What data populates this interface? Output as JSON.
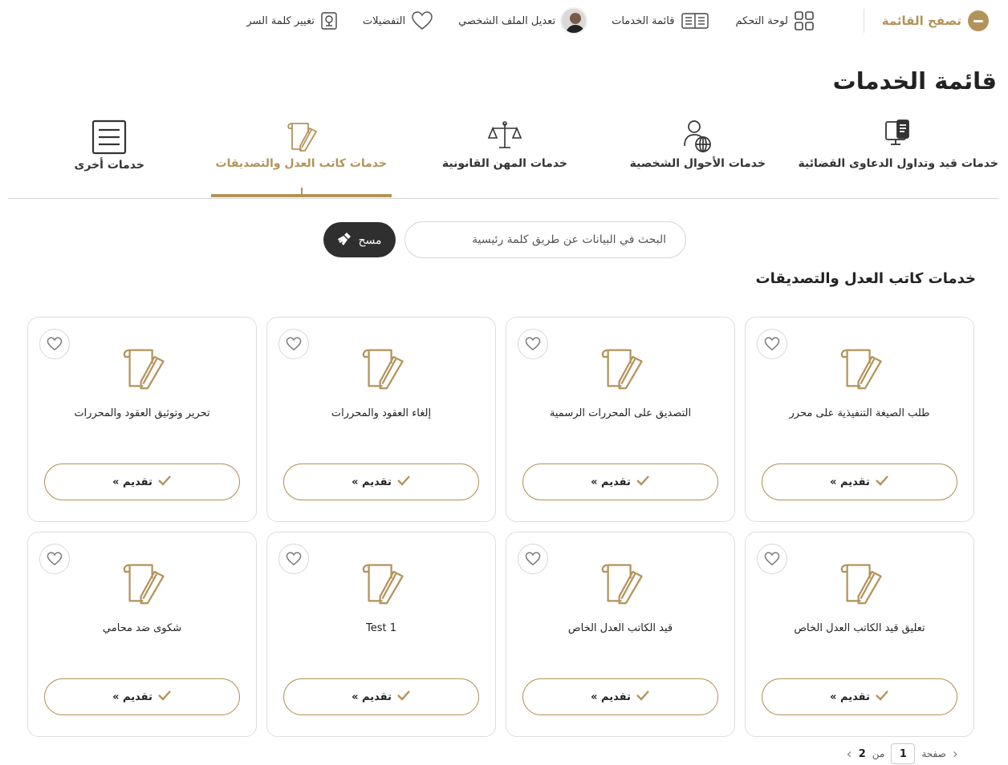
{
  "topnav": {
    "browse_label": "تصفح القائمة",
    "links": [
      {
        "label": "لوحة التحكم",
        "icon": "dashboard-icon"
      },
      {
        "label": "قائمة الخدمات",
        "icon": "services-list-icon"
      },
      {
        "label": "تعديل الملف الشخصي",
        "icon": "avatar"
      },
      {
        "label": "التفضيلات",
        "icon": "heart-icon"
      },
      {
        "label": "تغيير كلمة السر",
        "icon": "password-icon"
      }
    ]
  },
  "page_title": "قائمة الخدمات",
  "tabs": [
    {
      "label": "خدمات قيد وتداول الدعاوى القضائية",
      "icon": "court-cases-icon",
      "active": false
    },
    {
      "label": "خدمات الأحوال الشخصية",
      "icon": "personal-status-icon",
      "active": false
    },
    {
      "label": "خدمات المهن القانونية",
      "icon": "legal-professions-icon",
      "active": false
    },
    {
      "label": "خدمات كاتب العدل والتصديقات",
      "icon": "notary-icon",
      "active": true
    },
    {
      "label": "خدمات أخرى",
      "icon": "document-list-icon",
      "active": false
    }
  ],
  "search": {
    "placeholder": "البحث في البيانات عن طريق كلمة رئيسية",
    "clear_label": "مسح"
  },
  "section_title": "خدمات كاتب العدل والتصديقات",
  "cards": [
    {
      "title": "طلب الصيغة التنفيذية على محرر",
      "apply_label": "تقديم »"
    },
    {
      "title": "التصديق على المحررات الرسمية",
      "apply_label": "تقديم »"
    },
    {
      "title": "إلغاء العقود والمحررات",
      "apply_label": "تقديم »"
    },
    {
      "title": "تحرير وتوثيق العقود والمحررات",
      "apply_label": "تقديم »"
    },
    {
      "title": "تعليق قيد الكاتب العدل الخاص",
      "apply_label": "تقديم »"
    },
    {
      "title": "قيد الكاتب العدل الخاص",
      "apply_label": "تقديم »"
    },
    {
      "title": "Test 1",
      "apply_label": "تقديم »"
    },
    {
      "title": "شكوى ضد محامي",
      "apply_label": "تقديم »"
    }
  ],
  "pagination": {
    "page_label": "صفحة",
    "current": "1",
    "of_label": "من",
    "total": "2"
  },
  "colors": {
    "accent": "#b3935a",
    "dark_button": "#2f2f2f"
  }
}
